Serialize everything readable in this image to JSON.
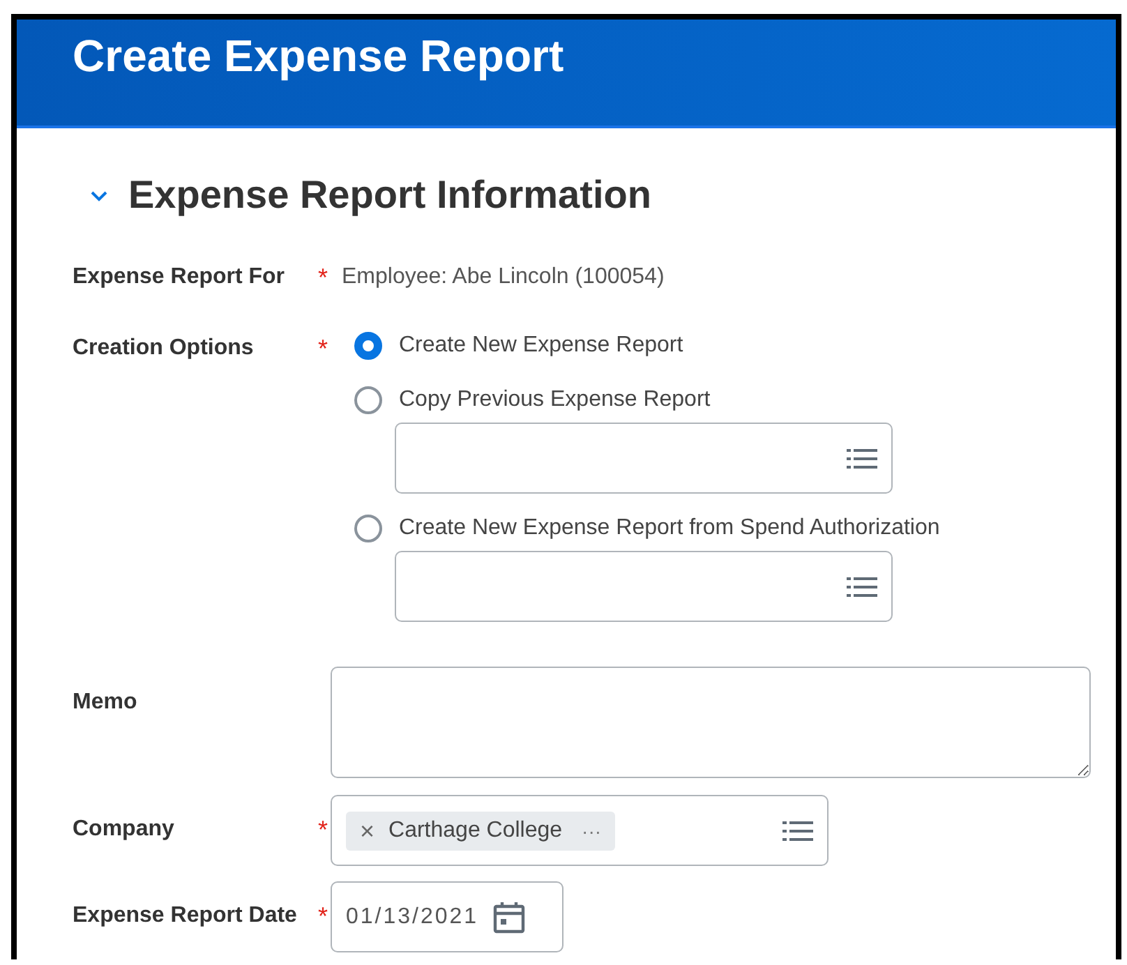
{
  "header": {
    "title": "Create Expense Report"
  },
  "section": {
    "title": "Expense Report Information",
    "expanded": true
  },
  "fields": [
    {
      "kind": "text",
      "label": "Expense Report For",
      "required_mark": "*",
      "value": "Employee: Abe Lincoln (100054)"
    },
    {
      "kind": "radio",
      "label": "Creation Options",
      "required_mark": "*",
      "options": [
        {
          "label": "Create New Expense Report",
          "selected": true,
          "has_prompt": false
        },
        {
          "label": "Copy Previous Expense Report",
          "selected": false,
          "has_prompt": true
        },
        {
          "label": "Create New Expense Report from Spend Authorization",
          "selected": false,
          "has_prompt": true
        }
      ]
    },
    {
      "kind": "textarea",
      "label": "Memo"
    },
    {
      "kind": "prompt",
      "label": "Company",
      "required_mark": "*",
      "chips": [
        {
          "remove": "×",
          "text": "Carthage College",
          "more": "···"
        }
      ]
    },
    {
      "kind": "date",
      "label": "Expense Report Date",
      "required_mark": "*",
      "value": "01/13/2021"
    }
  ]
}
